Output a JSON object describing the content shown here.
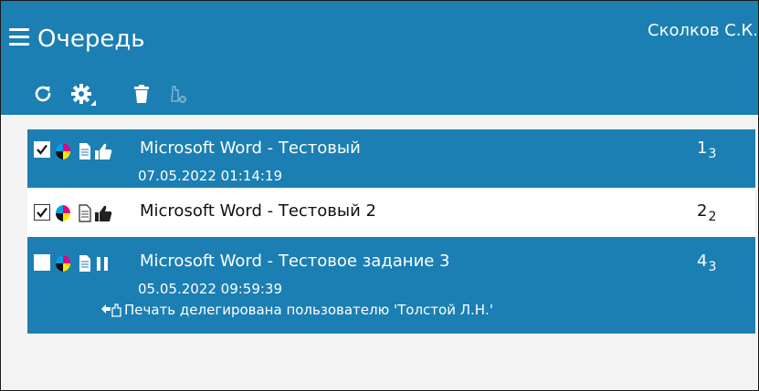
{
  "header": {
    "title": "Очередь",
    "user_name": "Сколков С.К.",
    "background": "#1b7fb3"
  },
  "toolbar": {
    "items": [
      "refresh-icon",
      "settings-icon",
      "delete-icon",
      "delegate-disabled-icon"
    ]
  },
  "jobs": [
    {
      "checked": true,
      "selected": true,
      "status_icon": "thumbs-up-icon",
      "title": "Microsoft Word - Тестовый",
      "date": "07.05.2022 01:14:19",
      "count": "1",
      "count_sub": "3"
    },
    {
      "checked": true,
      "selected": false,
      "status_icon": "thumbs-up-icon",
      "title": "Microsoft Word - Тестовый 2",
      "count": "2",
      "count_sub": "2"
    },
    {
      "checked": false,
      "selected": true,
      "status_icon": "pause-icon",
      "title": "Microsoft Word - Тестовое задание 3",
      "date": "05.05.2022 09:59:39",
      "count": "4",
      "count_sub": "3",
      "delegation": "Печать делегирована пользователю 'Толстой Л.Н.'"
    }
  ]
}
